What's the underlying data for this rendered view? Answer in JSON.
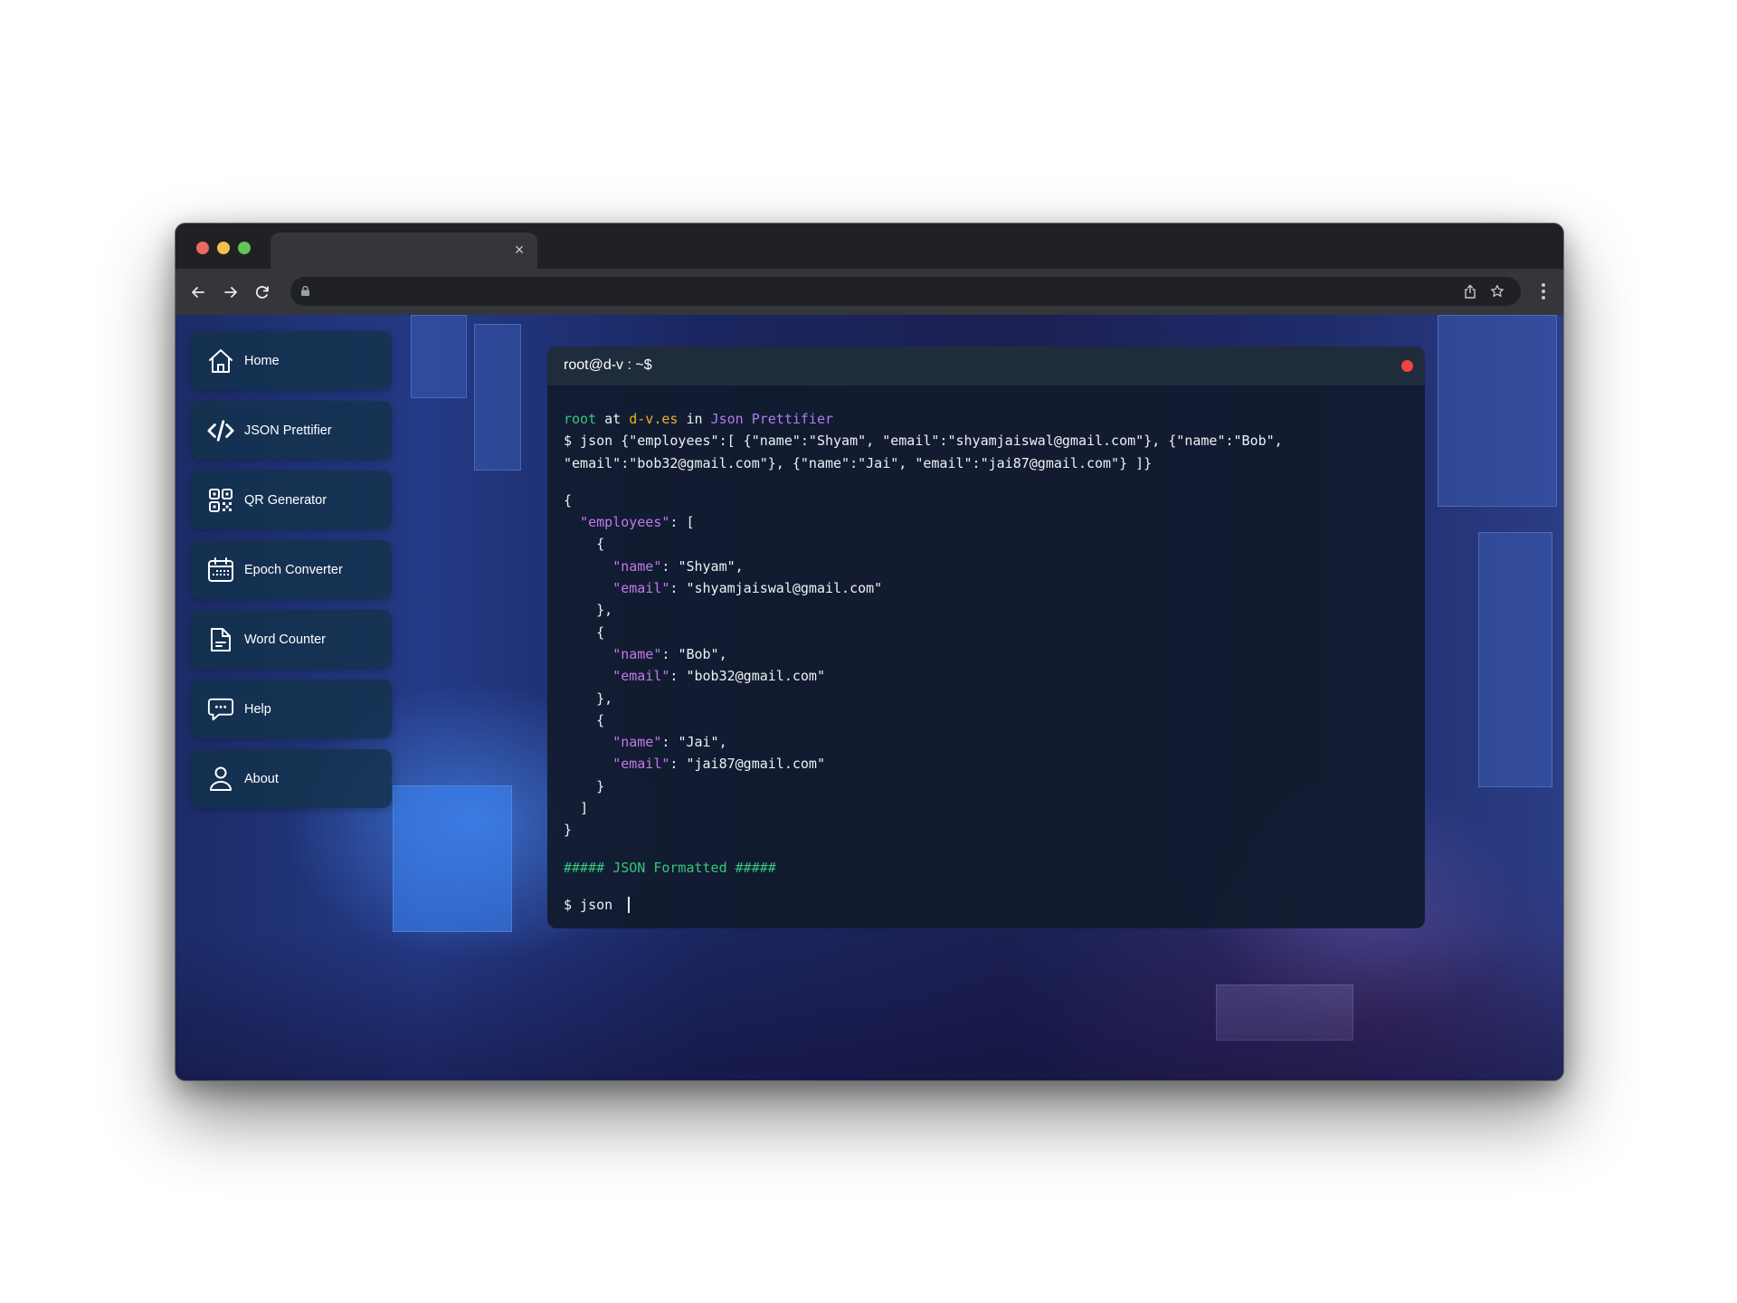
{
  "browser": {
    "tab": {
      "title": "",
      "close_icon": "×"
    },
    "toolbar": {
      "back_icon": "←",
      "forward_icon": "→",
      "reload_icon": "↻",
      "url": "",
      "share_icon": "⇪",
      "bookmark_icon": "☆"
    }
  },
  "sidebar": {
    "items": [
      {
        "label": "Home",
        "icon": "home-icon"
      },
      {
        "label": "JSON Prettifier",
        "icon": "code-icon"
      },
      {
        "label": "QR Generator",
        "icon": "qr-code-icon"
      },
      {
        "label": "Epoch Converter",
        "icon": "calendar-icon"
      },
      {
        "label": "Word Counter",
        "icon": "document-icon"
      },
      {
        "label": "Help",
        "icon": "chat-bubble-icon"
      },
      {
        "label": "About",
        "icon": "user-icon"
      }
    ]
  },
  "terminal": {
    "title": "root@d-v : ~$",
    "prompt_info": {
      "user": "root",
      "at": " at ",
      "host": "d-v.es",
      "in": " in ",
      "app": "Json Prettifier"
    },
    "command_lines": [
      "$ json {\"employees\":[ {\"name\":\"Shyam\", \"email\":\"shyamjaiswal@gmail.com\"}, {\"name\":\"Bob\",",
      "\"email\":\"bob32@gmail.com\"}, {\"name\":\"Jai\", \"email\":\"jai87@gmail.com\"} ]}"
    ],
    "output": {
      "open_brace": "{",
      "root_key": "\"employees\"",
      "root_sep": ": [",
      "employees": [
        {
          "name": "\"Shyam\"",
          "email": "\"shyamjaiswal@gmail.com\""
        },
        {
          "name": "\"Bob\"",
          "email": "\"bob32@gmail.com\""
        },
        {
          "name": "\"Jai\"",
          "email": "\"jai87@gmail.com\""
        }
      ],
      "name_key": "\"name\"",
      "email_key": "\"email\"",
      "close_bracket": "]",
      "close_brace": "}"
    },
    "status": "##### JSON Formatted #####",
    "current_input": "$ json "
  },
  "colors": {
    "prompt_user": "#34c77b",
    "prompt_host": "#e6b422",
    "prompt_app": "#b07cf0",
    "json_key": "#c07ae6",
    "status": "#34c77b",
    "close_dot": "#ef4444"
  }
}
